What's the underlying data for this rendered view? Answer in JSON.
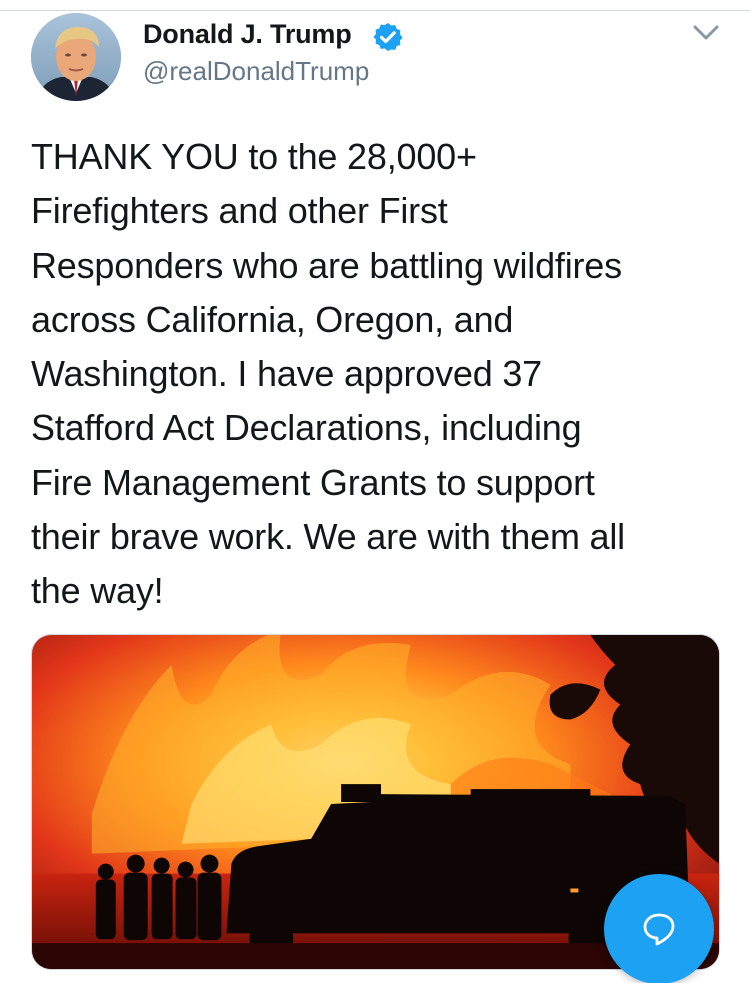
{
  "author": {
    "display_name": "Donald J. Trump",
    "handle": "@realDonaldTrump",
    "verified": true,
    "avatar_icon": "profile-photo"
  },
  "tweet": {
    "lines": [
      "THANK YOU to the 28,000+",
      "Firefighters and other First",
      "Responders who are battling wildfires",
      "across California, Oregon, and",
      "Washington. I have approved 37",
      "Stafford Act Declarations, including",
      "Fire Management Grants to support",
      "their brave work. We are with them all",
      "the way!"
    ]
  },
  "media": {
    "icon": "wildfire-photo"
  },
  "icons": {
    "more": "chevron-down-icon",
    "verified": "verified-badge-icon",
    "reply": "reply-bubble-icon"
  },
  "colors": {
    "text": "#14171a",
    "secondary": "#657786",
    "accent": "#1da1f2"
  }
}
